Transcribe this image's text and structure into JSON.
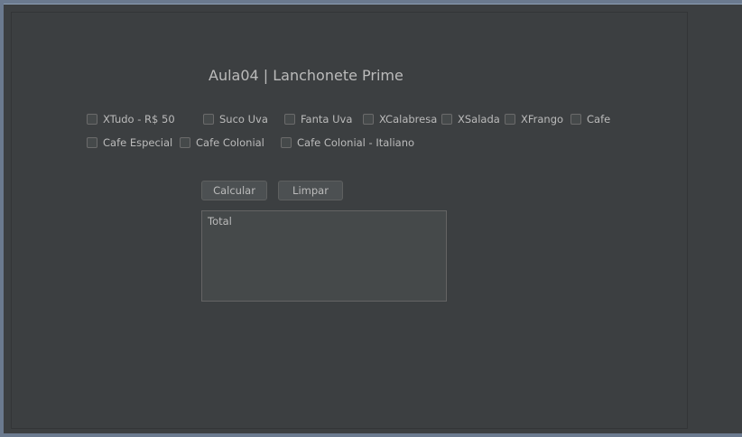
{
  "title": "Aula04 | Lanchonete Prime",
  "checkboxes": [
    {
      "label": "XTudo - R$ 50",
      "checked": false
    },
    {
      "label": "Suco Uva",
      "checked": false
    },
    {
      "label": "Fanta Uva",
      "checked": false
    },
    {
      "label": "XCalabresa",
      "checked": false
    },
    {
      "label": "XSalada",
      "checked": false
    },
    {
      "label": "XFrango",
      "checked": false
    },
    {
      "label": "Cafe",
      "checked": false
    },
    {
      "label": "Cafe Especial",
      "checked": false
    },
    {
      "label": "Cafe Colonial",
      "checked": false
    },
    {
      "label": "Cafe Colonial - Italiano",
      "checked": false
    }
  ],
  "buttons": {
    "calcular": "Calcular",
    "limpar": "Limpar"
  },
  "output": {
    "value": "Total"
  },
  "colors": {
    "background": "#3c3f41",
    "text": "#bbbbbb",
    "field": "#45494a"
  }
}
